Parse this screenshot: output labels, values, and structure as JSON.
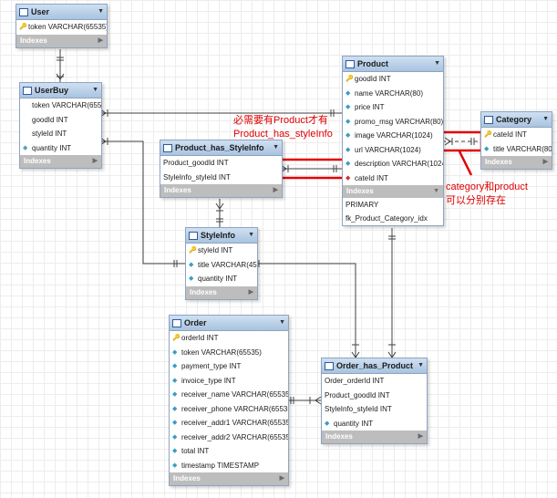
{
  "tables": {
    "user": {
      "name": "User",
      "columns": [
        {
          "text": "token VARCHAR(65535)",
          "icon": "key-icon"
        }
      ],
      "indexes_label": "Indexes"
    },
    "userbuy": {
      "name": "UserBuy",
      "columns": [
        {
          "text": "token VARCHAR(65535)",
          "icon": "none"
        },
        {
          "text": "goodId INT",
          "icon": "none"
        },
        {
          "text": "styleId INT",
          "icon": "none"
        },
        {
          "text": "quantity INT",
          "icon": "diamond-icon"
        }
      ],
      "indexes_label": "Indexes"
    },
    "product": {
      "name": "Product",
      "columns": [
        {
          "text": "goodId INT",
          "icon": "key-icon"
        },
        {
          "text": "name VARCHAR(80)",
          "icon": "diamond-icon"
        },
        {
          "text": "price INT",
          "icon": "diamond-icon"
        },
        {
          "text": "promo_msg VARCHAR(80)",
          "icon": "diamond-icon"
        },
        {
          "text": "image VARCHAR(1024)",
          "icon": "diamond-icon"
        },
        {
          "text": "url VARCHAR(1024)",
          "icon": "diamond-icon"
        },
        {
          "text": "description VARCHAR(1024)",
          "icon": "diamond-icon"
        },
        {
          "text": "cateId INT",
          "icon": "fk-icon"
        }
      ],
      "indexes_label": "Indexes",
      "index_rows": [
        "PRIMARY",
        "fk_Product_Category_idx"
      ]
    },
    "category": {
      "name": "Category",
      "columns": [
        {
          "text": "cateId INT",
          "icon": "key-icon"
        },
        {
          "text": "title VARCHAR(80)",
          "icon": "diamond-icon"
        }
      ],
      "indexes_label": "Indexes"
    },
    "phs": {
      "name": "Product_has_StyleInfo",
      "columns": [
        {
          "text": "Product_goodId INT",
          "icon": "none"
        },
        {
          "text": "StyleInfo_styleId INT",
          "icon": "none"
        }
      ],
      "indexes_label": "Indexes"
    },
    "styleinfo": {
      "name": "StyleInfo",
      "columns": [
        {
          "text": "styleId INT",
          "icon": "key-icon"
        },
        {
          "text": "title VARCHAR(45)",
          "icon": "diamond-icon"
        },
        {
          "text": "quantity INT",
          "icon": "diamond-icon"
        }
      ],
      "indexes_label": "Indexes"
    },
    "order": {
      "name": "Order",
      "columns": [
        {
          "text": "orderId INT",
          "icon": "key-icon"
        },
        {
          "text": "token VARCHAR(65535)",
          "icon": "diamond-icon"
        },
        {
          "text": "payment_type INT",
          "icon": "diamond-icon"
        },
        {
          "text": "invoice_type INT",
          "icon": "diamond-icon"
        },
        {
          "text": "receiver_name VARCHAR(65535)",
          "icon": "diamond-icon"
        },
        {
          "text": "receiver_phone VARCHAR(65535)",
          "icon": "diamond-icon"
        },
        {
          "text": "receiver_addr1 VARCHAR(65535)",
          "icon": "diamond-icon"
        },
        {
          "text": "receiver_addr2 VARCHAR(65535)",
          "icon": "diamond-icon"
        },
        {
          "text": "total INT",
          "icon": "diamond-icon"
        },
        {
          "text": "timestamp TIMESTAMP",
          "icon": "diamond-icon"
        }
      ],
      "indexes_label": "Indexes"
    },
    "ohp": {
      "name": "Order_has_Product",
      "columns": [
        {
          "text": "Order_orderId INT",
          "icon": "none"
        },
        {
          "text": "Product_goodId INT",
          "icon": "none"
        },
        {
          "text": "StyleInfo_styleId INT",
          "icon": "none"
        },
        {
          "text": "quantity INT",
          "icon": "diamond-icon"
        }
      ],
      "indexes_label": "Indexes"
    }
  },
  "annotations": {
    "note1": [
      "必需要有Product才有",
      "Product_has_styleInfo"
    ],
    "note2": [
      "category和product",
      "可以分别存在"
    ]
  },
  "colors": {
    "annotation": "#e00000",
    "highlight_box": "#e00000",
    "header": "#b7cde6",
    "indexes_bar": "#bdbdbd"
  }
}
